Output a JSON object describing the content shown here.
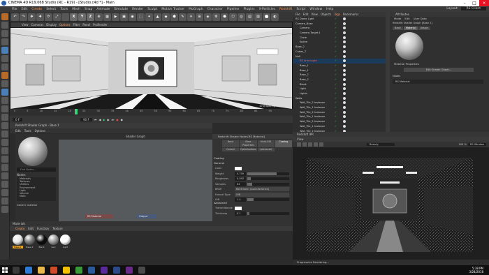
{
  "window": {
    "title": "CINEMA 4D R19.068 Studio (RC - R19) - [Studio.c4d *] - Main"
  },
  "menubar": {
    "items": [
      "File",
      "Edit",
      "Create",
      "Select",
      "Tools",
      "Mesh",
      "Snap",
      "Animate",
      "Simulate",
      "Render",
      "Sculpt",
      "Motion Tracker",
      "MoGraph",
      "Character",
      "Pipeline",
      "Plugins",
      "X-Particles",
      "Redshift",
      "Script",
      "Window",
      "Help"
    ],
    "layout_label": "Layout:",
    "layout_value": "RS Client"
  },
  "viewport": {
    "menu": [
      "View",
      "Cameras",
      "Display",
      "Options",
      "Filter",
      "Panel",
      "ProRender"
    ],
    "label": "Perspective",
    "grid_spacing": "Grid Spacing : 10000 cm"
  },
  "timeline": {
    "ticks": [
      "0",
      "5",
      "10",
      "15",
      "20",
      "25",
      "30",
      "35",
      "40",
      "45",
      "50",
      "55",
      "60",
      "65",
      "70",
      "75",
      "80",
      "85",
      "90"
    ],
    "frame_field": "0 F",
    "end_field": "90 F"
  },
  "shader_graph": {
    "window_title": "Redshift Shader Graph - Base 1",
    "menu": [
      "Edit",
      "Tools",
      "Options"
    ],
    "panel_title": "Shader Graph",
    "find_placeholder": "Find Nodes...",
    "nodes_label": "Nodes",
    "node_categories": [
      "Materials",
      "Textures",
      "Utilities",
      "Environment",
      "Light",
      "Volume",
      "Math"
    ],
    "generic_label": "Generic material",
    "graph_nodes": {
      "material": "RS Material",
      "output": "Output"
    }
  },
  "node_attributes": {
    "title": "Redshift Shader Node [RS Material]",
    "tabs": [
      "Basic",
      "Base Properties",
      "Multi-SSS",
      "Coating",
      "Overall",
      "Optimizations",
      "Advanced"
    ],
    "active_tab": "Coating",
    "section": "Coating",
    "group": "General",
    "rows": [
      {
        "k": "Color",
        "type": "swatch"
      },
      {
        "k": "Weight",
        "v": "0.709",
        "fill": 0.7
      },
      {
        "k": "Roughness",
        "v": "0.093",
        "fill": 0.09
      },
      {
        "k": "Samples",
        "v": "64",
        "fill": 0.12
      },
      {
        "k": "BRDF",
        "v": "Beckmann (Cook-Torrance)",
        "type": "dd"
      },
      {
        "k": "Fresnel Type",
        "v": "IOR",
        "type": "dd"
      },
      {
        "k": "IOR",
        "v": "1.4",
        "fill": 0.15
      }
    ],
    "adv_group": "Advanced",
    "adv_rows": [
      {
        "k": "Transmittance",
        "type": "swatch"
      },
      {
        "k": "Thickness",
        "v": "0.1",
        "fill": 0.05
      }
    ]
  },
  "materials": {
    "header": "Materials",
    "menu": [
      "Create",
      "Edit",
      "Function",
      "Texture"
    ],
    "items": [
      {
        "label": "Base 1",
        "color": "#e8e8e8",
        "selected": true
      },
      {
        "label": "Base 2",
        "color": "#7a7a7a"
      },
      {
        "label": "Black",
        "color": "#0e0e0e"
      },
      {
        "label": "Gen",
        "color": "#9a9a9a"
      },
      {
        "label": "Light",
        "color": "#ffffff"
      }
    ]
  },
  "objects": {
    "menu": [
      "File",
      "Edit",
      "View",
      "Objects",
      "Tags",
      "Bookmarks"
    ],
    "rows": [
      {
        "n": "RS Dome Light",
        "d": 0
      },
      {
        "n": "Camera_Base",
        "d": 0
      },
      {
        "n": "Camera",
        "d": 1
      },
      {
        "n": "Camera.Target.1",
        "d": 1
      },
      {
        "n": "Circle",
        "d": 1
      },
      {
        "n": "Spline",
        "d": 1
      },
      {
        "n": "Base_2",
        "d": 0
      },
      {
        "n": "Cubes_T",
        "d": 0
      },
      {
        "n": "Null",
        "d": 0
      },
      {
        "n": "RS Area Light",
        "d": 1,
        "hi": true
      },
      {
        "n": "Base_1",
        "d": 1
      },
      {
        "n": "Base_1",
        "d": 1
      },
      {
        "n": "Base_2",
        "d": 1
      },
      {
        "n": "Base_2",
        "d": 1
      },
      {
        "n": "Black",
        "d": 1
      },
      {
        "n": "Light",
        "d": 1
      },
      {
        "n": "Lights",
        "d": 1
      },
      {
        "n": "Walls",
        "d": 0
      },
      {
        "n": "Wall_Tile_2 Instance",
        "d": 1
      },
      {
        "n": "Wall_Tile_1 Instance",
        "d": 1
      },
      {
        "n": "Wall_Tile_2 Instance",
        "d": 1
      },
      {
        "n": "Wall_Tile_1 Instance",
        "d": 1
      },
      {
        "n": "Wall_Tile_2 Instance",
        "d": 1
      },
      {
        "n": "Wall_Tile_1 Instance",
        "d": 1
      },
      {
        "n": "Wall_Tile_2 Instance",
        "d": 1
      }
    ]
  },
  "attributes": {
    "header": "Attributes",
    "menu": [
      "Mode",
      "Edit",
      "User Data"
    ],
    "subtitle": "Redshift Shader Graph [Base 1]",
    "tabs": [
      "Basic",
      "Material",
      "Assign"
    ],
    "active_tab": "Material",
    "props_label": "Material Properties",
    "edit_button": "Edit Shader Graph...",
    "nodes_label": "Nodes",
    "node_item": "RS Material"
  },
  "ipr": {
    "header": "Redshift IPR",
    "menu": "View",
    "channel": "Beauty",
    "zoom": "100 %",
    "aov": "RS Window",
    "status": "Progressive Rendering..."
  },
  "taskbar": {
    "time": "5:38 PM",
    "date": "3/28/2018"
  }
}
